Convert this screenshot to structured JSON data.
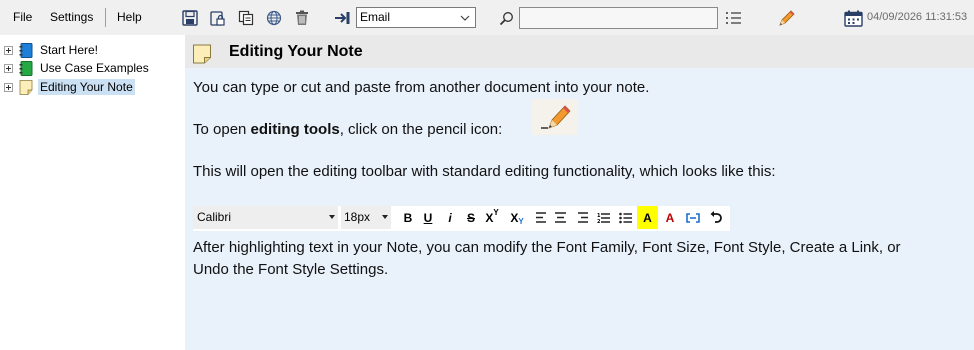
{
  "menu": {
    "file": "File",
    "settings": "Settings",
    "help": "Help"
  },
  "toolbar": {
    "icons": [
      "save-icon",
      "lock-save-icon",
      "copy-icon",
      "globe-icon",
      "trash-icon",
      "export-icon"
    ],
    "export_target": "Email",
    "search_value": "",
    "datetime": "04/09/2026 11:31:53"
  },
  "sidebar": {
    "items": [
      {
        "label": "Start Here!",
        "icon": "blue-notebook-icon",
        "selected": false
      },
      {
        "label": "Use Case Examples",
        "icon": "green-notebook-icon",
        "selected": false
      },
      {
        "label": "Editing Your Note",
        "icon": "note-icon",
        "selected": true
      }
    ]
  },
  "note": {
    "title": "Editing Your Note",
    "p1": "You can type or cut and paste from another document into your note.",
    "p2_before": "To open ",
    "p2_bold": "editing tools",
    "p2_after": ", click on the pencil icon:",
    "p3": "This will open the editing toolbar with standard editing functionality, which looks like this:",
    "p4_line1": "After highlighting text in your Note, you can modify the Font Family, Font Size, Font Style, Create a Link, or",
    "p4_line2": "Undo the Font Style Settings."
  },
  "editing_toolbar": {
    "font_family": "Calibri",
    "font_size": "18px",
    "buttons": {
      "bold": "B",
      "underline": "U",
      "italic": "i",
      "strike": "S",
      "superscript": "X",
      "superscript_mark": "Y",
      "subscript": "X",
      "subscript_mark": "Y",
      "highlight": "A",
      "font_color": "A"
    },
    "colors": {
      "highlight": "#ffff00",
      "font_color": "#c00000",
      "accent_blue": "#1f6fd1"
    }
  }
}
